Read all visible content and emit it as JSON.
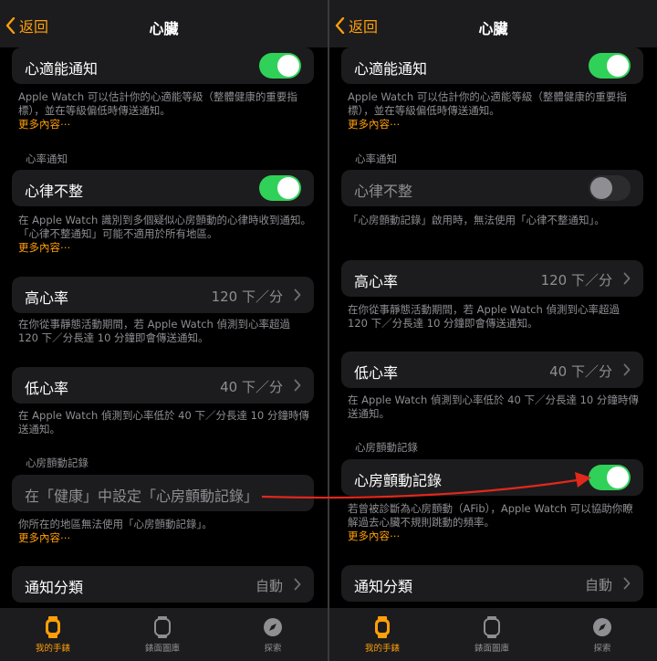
{
  "nav": {
    "back_label": "返回",
    "title": "心臟"
  },
  "tabs": [
    {
      "label": "我的手錶"
    },
    {
      "label": "錶面圖庫"
    },
    {
      "label": "探索"
    }
  ],
  "colors": {
    "accent": "#ff9f0a",
    "toggle_on": "#30d158",
    "background": "#000000",
    "cell": "#1c1c1e",
    "arrow": "#e0281c"
  },
  "left": {
    "cardio": {
      "label": "心適能通知",
      "toggle_on": true,
      "footer": "Apple Watch 可以估計你的心適能等級（整體健康的重要指標），並在等級偏低時傳送通知。",
      "more": "更多內容⋯"
    },
    "hr_section": "心率通知",
    "irregular": {
      "label": "心律不整",
      "toggle_on": true,
      "footer": "在 Apple Watch 識別到多個疑似心房顫動的心律時收到通知。「心律不整通知」可能不適用於所有地區。",
      "more": "更多內容⋯"
    },
    "high": {
      "label": "高心率",
      "value": "120 下／分",
      "footer": "在你從事靜態活動期間，若 Apple Watch 偵測到心率超過 120 下／分長達 10 分鐘即會傳送通知。"
    },
    "low": {
      "label": "低心率",
      "value": "40 下／分",
      "footer": "在 Apple Watch 偵測到心率低於 40 下／分長達 10 分鐘時傳送通知。"
    },
    "afib_section": "心房顫動記錄",
    "afib": {
      "label": "在「健康」中設定「心房顫動記錄」",
      "footer": "你所在的地區無法使用「心房顫動記錄」。",
      "more": "更多內容⋯"
    },
    "notif": {
      "label": "通知分類",
      "value": "自動"
    }
  },
  "right": {
    "cardio": {
      "label": "心適能通知",
      "toggle_on": true,
      "footer": "Apple Watch 可以估計你的心適能等級（整體健康的重要指標），並在等級偏低時傳送通知。",
      "more": "更多內容⋯"
    },
    "hr_section": "心率通知",
    "irregular": {
      "label": "心律不整",
      "toggle_on": false,
      "footer": "「心房顫動記錄」啟用時，無法使用「心律不整通知」。"
    },
    "high": {
      "label": "高心率",
      "value": "120 下／分",
      "footer": "在你從事靜態活動期間，若 Apple Watch 偵測到心率超過 120 下／分長達 10 分鐘即會傳送通知。"
    },
    "low": {
      "label": "低心率",
      "value": "40 下／分",
      "footer": "在 Apple Watch 偵測到心率低於 40 下／分長達 10 分鐘時傳送通知。"
    },
    "afib_section": "心房顫動記錄",
    "afib": {
      "label": "心房顫動記錄",
      "toggle_on": true,
      "footer": "若曾被診斷為心房顫動（AFib），Apple Watch 可以協助你瞭解過去心臟不規則跳動的頻率。",
      "more": "更多內容⋯"
    },
    "notif": {
      "label": "通知分類",
      "value": "自動"
    }
  }
}
